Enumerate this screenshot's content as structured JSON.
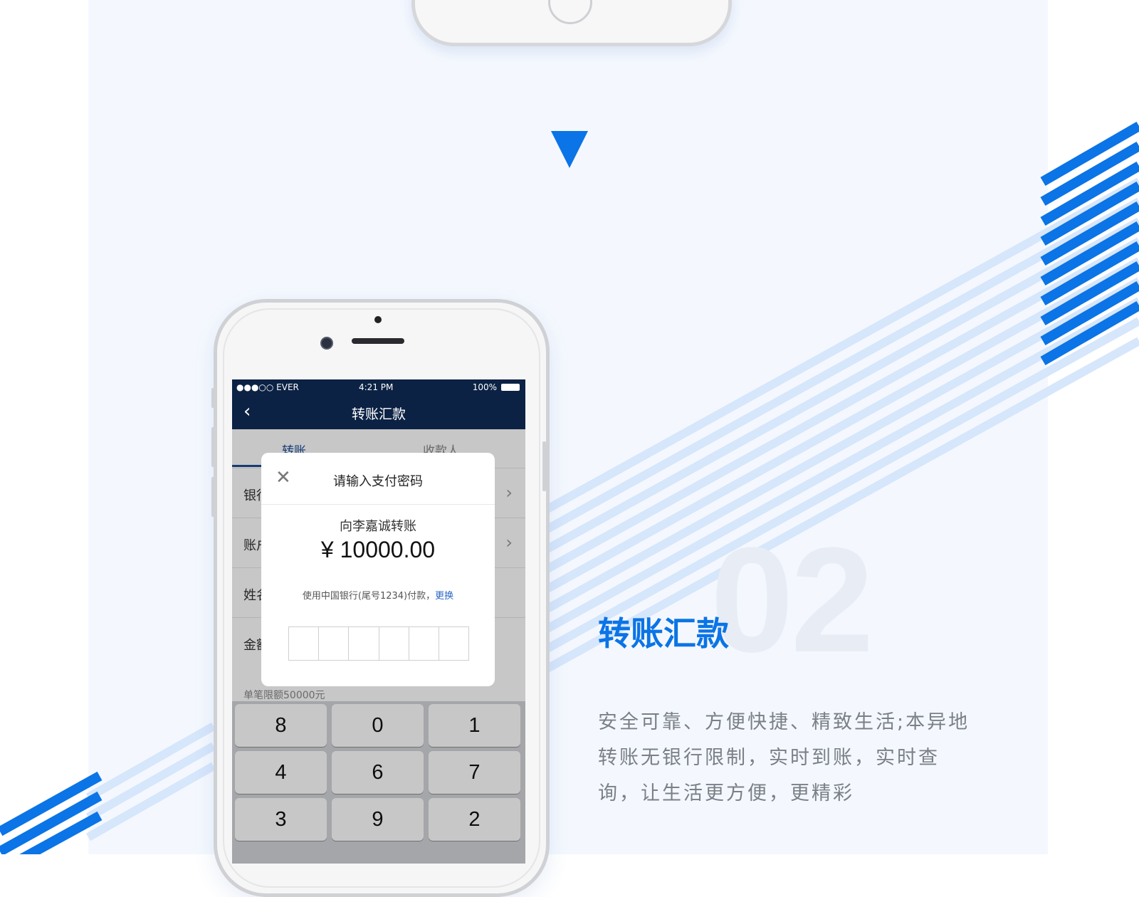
{
  "colors": {
    "accent": "#0b74e6",
    "nav_bg": "#0c2244",
    "panel_bg": "#f4f8fe"
  },
  "status_bar": {
    "carrier": "●●●○○ EVER",
    "time": "4:21 PM",
    "battery": "100%"
  },
  "nav": {
    "title": "转账汇款"
  },
  "tabs": [
    {
      "label": "转账"
    },
    {
      "label": "收款人"
    }
  ],
  "form_rows": [
    {
      "label": "银行"
    },
    {
      "label": "账户"
    },
    {
      "label": "姓名"
    },
    {
      "label": "金额"
    }
  ],
  "limit_text": "单笔限额50000元",
  "dialog": {
    "title": "请输入支付密码",
    "recipient": "向李嘉诚转账",
    "amount": "¥ 10000.00",
    "pay_text": "使用中国银行(尾号1234)付款，",
    "change_link": "更换"
  },
  "keypad": {
    "keys": [
      "8",
      "0",
      "1",
      "4",
      "6",
      "7",
      "3",
      "9",
      "2"
    ]
  },
  "feature": {
    "number": "02",
    "title": "转账汇款",
    "description_lines": [
      "安全可靠、方便快捷、精致生活;本异地",
      "转账无银行限制，实时到账，实时查",
      "询，让生活更方便，更精彩"
    ]
  }
}
